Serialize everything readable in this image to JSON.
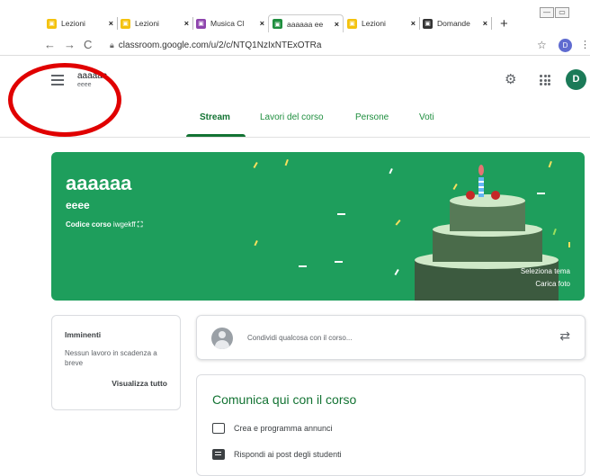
{
  "browser": {
    "tabs": [
      {
        "title": "Lezioni",
        "favicon_color": "#f4c20d",
        "active": false
      },
      {
        "title": "Lezioni",
        "favicon_color": "#f4c20d",
        "active": false
      },
      {
        "title": "Musica Cl",
        "favicon_color": "#8e44ad",
        "active": false
      },
      {
        "title": "aaaaaa ee",
        "favicon_color": "#1e8e3e",
        "active": true
      },
      {
        "title": "Lezioni",
        "favicon_color": "#f4c20d",
        "active": false
      },
      {
        "title": "Domande",
        "favicon_color": "#333333",
        "active": false
      }
    ],
    "close_glyph": "×",
    "new_tab_glyph": "+",
    "url": "classroom.google.com/u/2/c/NTQ1NzIxNTExOTRa",
    "profile_initial": "D"
  },
  "header": {
    "class_name": "aaaaaa",
    "class_section": "eeee",
    "avatar_initial": "D",
    "tabs": [
      {
        "label": "Stream",
        "active": true
      },
      {
        "label": "Lavori del corso",
        "active": false
      },
      {
        "label": "Persone",
        "active": false
      },
      {
        "label": "Voti",
        "active": false
      }
    ]
  },
  "banner": {
    "title": "aaaaaa",
    "section": "eeee",
    "code_label": "Codice corso",
    "code_value": "iwgekff",
    "select_theme": "Seleziona tema",
    "upload_photo": "Carica foto",
    "color": "#1e9e5c"
  },
  "upcoming": {
    "title": "Imminenti",
    "text": "Nessun lavoro in scadenza a breve",
    "link": "Visualizza tutto"
  },
  "share": {
    "placeholder": "Condividi qualcosa con il corso..."
  },
  "communicate": {
    "title": "Comunica qui con il corso",
    "items": [
      {
        "label": "Crea e programma annunci",
        "icon": "announcement-icon"
      },
      {
        "label": "Rispondi ai post degli studenti",
        "icon": "reply-icon"
      }
    ]
  },
  "colors": {
    "accent_green": "#137333",
    "annotation_red": "#e00000"
  }
}
